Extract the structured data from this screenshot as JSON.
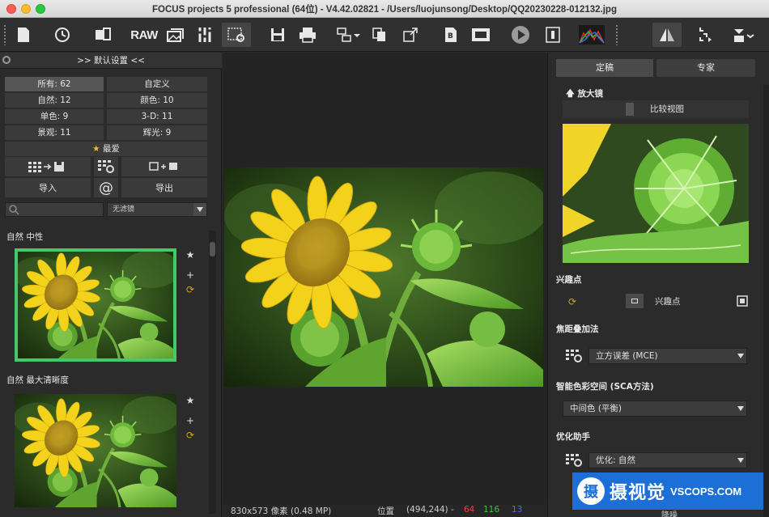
{
  "window": {
    "title": "FOCUS projects 5 professional (64位) - V4.42.02821 - /Users/luojunsong/Desktop/QQ20230228-012132.jpg"
  },
  "toolbar": {
    "raw_label": "RAW",
    "icons": [
      "new-file-icon",
      "history-icon",
      "batch-icon",
      "raw-icon",
      "gallery-icon",
      "tools-icon",
      "settings-icon",
      "save-icon",
      "print-icon",
      "export-icon",
      "copy-icon",
      "share-icon",
      "adjust-icon",
      "frame-icon",
      "play-icon",
      "info-icon",
      "histogram-icon",
      "compare-icon",
      "crop-icon",
      "stack-icon"
    ]
  },
  "left_panel": {
    "header": ">> 默认设置 <<",
    "categories": [
      {
        "label": "所有: 62",
        "selected": true
      },
      {
        "label": "自定义"
      },
      {
        "label": "自然: 12"
      },
      {
        "label": "颜色: 10"
      },
      {
        "label": "单色: 9"
      },
      {
        "label": "3-D: 11"
      },
      {
        "label": "景观: 11"
      },
      {
        "label": "辉光: 9"
      }
    ],
    "favorites": "最爱",
    "import_label": "导入",
    "export_label": "导出",
    "filter_placeholder": "无滤镜",
    "presets": [
      {
        "label": "自然 中性",
        "selected": true
      },
      {
        "label": "自然 最大清晰度",
        "selected": false
      }
    ]
  },
  "status": {
    "dimensions": "830x573 像素 (0.48 MP)",
    "position_label": "位置",
    "position_value": "(494,244) -",
    "r": "64",
    "g": "116",
    "b": "13"
  },
  "right_panel": {
    "tabs": [
      {
        "label": "定稿",
        "active": true
      },
      {
        "label": "专家",
        "active": false
      }
    ],
    "magnifier": "放大镜",
    "compare_view": "比较视图",
    "poi_section": "兴趣点",
    "poi_button": "兴趣点",
    "stack_section": "焦距叠加法",
    "stack_method": "立方误差 (MCE)",
    "sca_section": "智能色彩空间 (SCA方法)",
    "sca_value": "中间色 (平衡)",
    "optimize_section": "优化助手",
    "optimize_value": "优化: 自然",
    "denoise": "降噪"
  },
  "watermark": {
    "cn": "摄视觉",
    "en": "VSCOPS.COM",
    "logo_char": "摄"
  },
  "colors": {
    "selection_green": "#43c86a",
    "red_value": "#e84040",
    "green_value": "#3cc83c",
    "blue_value": "#4a6ae8",
    "brand_blue": "#1d6fd8"
  }
}
